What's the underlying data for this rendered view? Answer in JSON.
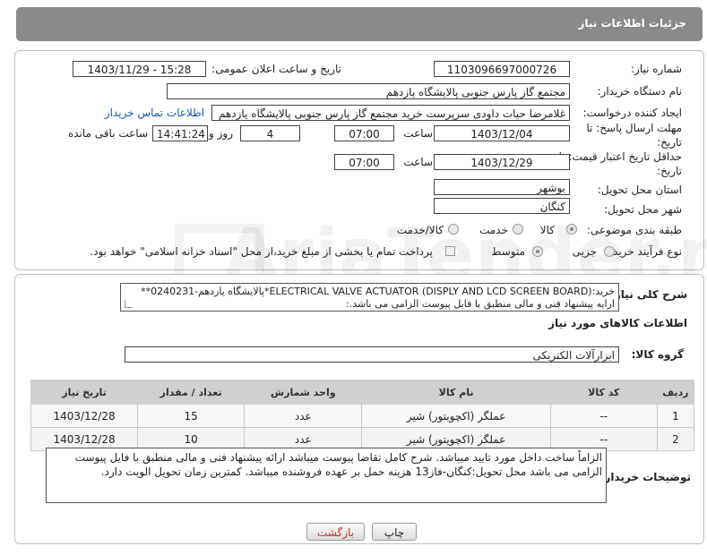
{
  "header": {
    "title": "جزئیات اطلاعات نیاز"
  },
  "form": {
    "need_number_label": "شماره نیاز:",
    "need_number": "1103096697000726",
    "announce_label": "تاریخ و ساعت اعلان عمومی:",
    "announce_value": "1403/11/29 - 15:28",
    "buyer_org_label": "نام دستگاه خریدار:",
    "buyer_org": "مجتمع گاز پارس جنوبی  پالایشگاه یازدهم",
    "requester_label": "ایجاد کننده درخواست:",
    "requester": "غلامرضا حیات داودی سرپرست خرید مجتمع گاز پارس جنوبی  پالایشگاه یازدهم",
    "contact_link": "اطلاعات تماس خریدار",
    "deadline_label_1": "مهلت ارسال پاسخ: تا",
    "deadline_label_2": "تاریخ:",
    "deadline_date": "1403/12/04",
    "time_label": "ساعت",
    "deadline_time": "07:00",
    "days_value": "4",
    "days_label": "روز و",
    "remaining_time": "14:41:24",
    "remaining_label": "ساعت باقی مانده",
    "validity_label_1": "حداقل تاریخ اعتبار قیمت: تا",
    "validity_label_2": "تاریخ:",
    "validity_date": "1403/12/29",
    "validity_time_label": "ساعت",
    "validity_time": "07:00",
    "province_label": "استان محل تحویل:",
    "province": "بوشهر",
    "city_label": "شهر محل تحویل:",
    "city": "کنگان",
    "category_label": "طبقه بندی موضوعی:",
    "category_options": [
      "کالا",
      "خدمت",
      "کالا/خدمت"
    ],
    "category_selected": "کالا",
    "process_label": "نوع فرآیند خرید :",
    "process_options": [
      "جزیی",
      "متوسط"
    ],
    "process_selected": "متوسط",
    "payment_note": "پرداخت تمام یا بخشی از مبلغ خرید،از محل \"اسناد خزانه اسلامی\" خواهد بود."
  },
  "summary": {
    "label": "شرح کلی نیاز:",
    "line1": "خرید:(ELECTRICAL VALVE ACTUATOR (DISPLY AND LCD SCREEN BOARD*پالایشگاه یازدهم-0240231**",
    "line2": "ارایه پیشنهاد فنی و مالی منطبق با فایل پیوست الزامی می باشد.:"
  },
  "goods": {
    "section_title": "اطلاعات کالاهای مورد نیاز",
    "group_label": "گروه کالا:",
    "group_value": "ابزارآلات الکتریکی",
    "columns": [
      "ردیف",
      "کد کالا",
      "نام کالا",
      "واحد شمارش",
      "تعداد / مقدار",
      "تاریخ نیاز"
    ],
    "rows": [
      {
        "row": "1",
        "code": "--",
        "name": "عملگر (اکچویتور) شیر",
        "unit": "عدد",
        "qty": "15",
        "date": "1403/12/28"
      },
      {
        "row": "2",
        "code": "--",
        "name": "عملگر (اکچویتور) شیر",
        "unit": "عدد",
        "qty": "10",
        "date": "1403/12/28"
      }
    ]
  },
  "buyer_notes": {
    "label": "توضیحات خریدار:",
    "text": "الزاماً ساخت داخل مورد تایید میباشد. شرح کامل تقاضا پیوست میباشد ارائه پیشنهاد فنی و مالی منطبق با فایل پیوست الزامی می باشد محل تحویل:کنگان-فاز13 هزینه حمل بر عهده فروشنده میباشد. کمترین زمان تحویل الویت دارد."
  },
  "buttons": {
    "print": "چاپ",
    "back": "بازگشت"
  },
  "watermark": "AriaTender.neT",
  "colors": {
    "header_bg": "#8a8a8a",
    "link": "#1a56b5",
    "back_button_text": "#c0392b"
  }
}
